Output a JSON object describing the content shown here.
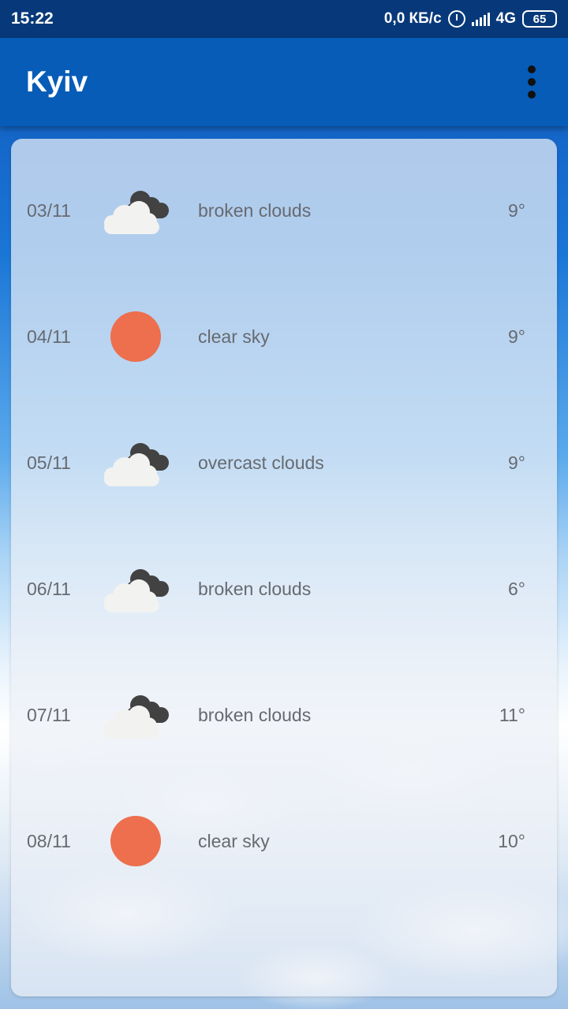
{
  "status_bar": {
    "time": "15:22",
    "network_speed": "0,0 КБ/с",
    "network_type": "4G",
    "battery": "65",
    "icons": [
      "alarm-icon",
      "signal-icon",
      "battery-icon"
    ]
  },
  "app_bar": {
    "title": "Kyiv",
    "menu_icon": "more-vert-icon",
    "color": "#065cb7"
  },
  "forecast": [
    {
      "date": "03/11",
      "icon": "broken-clouds-icon",
      "description": "broken clouds",
      "temp": "9°"
    },
    {
      "date": "04/11",
      "icon": "sun-icon",
      "description": "clear sky",
      "temp": "9°"
    },
    {
      "date": "05/11",
      "icon": "overcast-clouds-icon",
      "description": "overcast clouds",
      "temp": "9°"
    },
    {
      "date": "06/11",
      "icon": "broken-clouds-icon",
      "description": "broken clouds",
      "temp": "6°"
    },
    {
      "date": "07/11",
      "icon": "broken-clouds-icon",
      "description": "broken clouds",
      "temp": "11°"
    },
    {
      "date": "08/11",
      "icon": "sun-icon",
      "description": "clear sky",
      "temp": "10°"
    }
  ],
  "colors": {
    "sun": "#ed6f4e",
    "status_bar": "#07397a"
  }
}
